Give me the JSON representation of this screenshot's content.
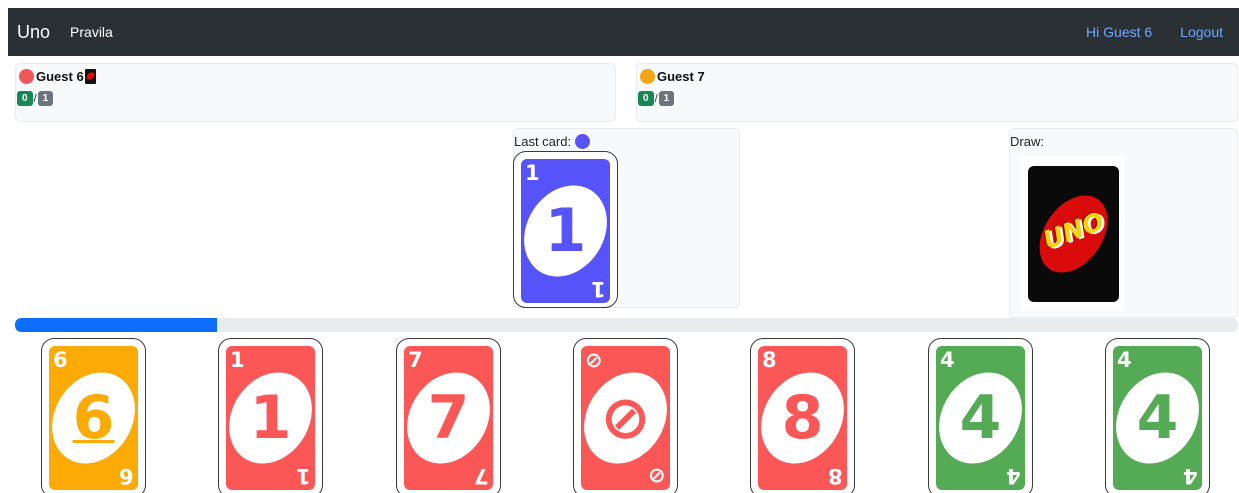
{
  "navbar": {
    "brand": "Uno",
    "rules_link": "Pravila",
    "greeting": "Hi Guest 6",
    "logout": "Logout"
  },
  "players": [
    {
      "name": "Guest 6",
      "color": "#f0575a",
      "count_a": "0",
      "count_b": "1",
      "has_uno_icon": true
    },
    {
      "name": "Guest 7",
      "color": "#f3a614",
      "count_a": "0",
      "count_b": "1",
      "has_uno_icon": false
    }
  ],
  "last_card": {
    "label": "Last card:",
    "color_hex": "#5553f9",
    "card": {
      "symbol": "1",
      "color": "#5553f9"
    }
  },
  "draw_pile": {
    "label": "Draw:",
    "logo_text": "UNO"
  },
  "timer": {
    "progress_percent": 16.5
  },
  "hand": [
    {
      "symbol": "6",
      "color": "#fcaa05",
      "underline": true
    },
    {
      "symbol": "1",
      "color": "#fc5757",
      "underline": false
    },
    {
      "symbol": "7",
      "color": "#fc5757",
      "underline": false
    },
    {
      "symbol": "⊘",
      "color": "#fc5757",
      "underline": false
    },
    {
      "symbol": "8",
      "color": "#fc5757",
      "underline": false
    },
    {
      "symbol": "4",
      "color": "#55aa55",
      "underline": false
    },
    {
      "symbol": "4",
      "color": "#55aa55",
      "underline": false
    }
  ],
  "icons": {
    "player_uno_badge": "uno-card-mini-icon",
    "color_dot": "color-dot-icon"
  }
}
